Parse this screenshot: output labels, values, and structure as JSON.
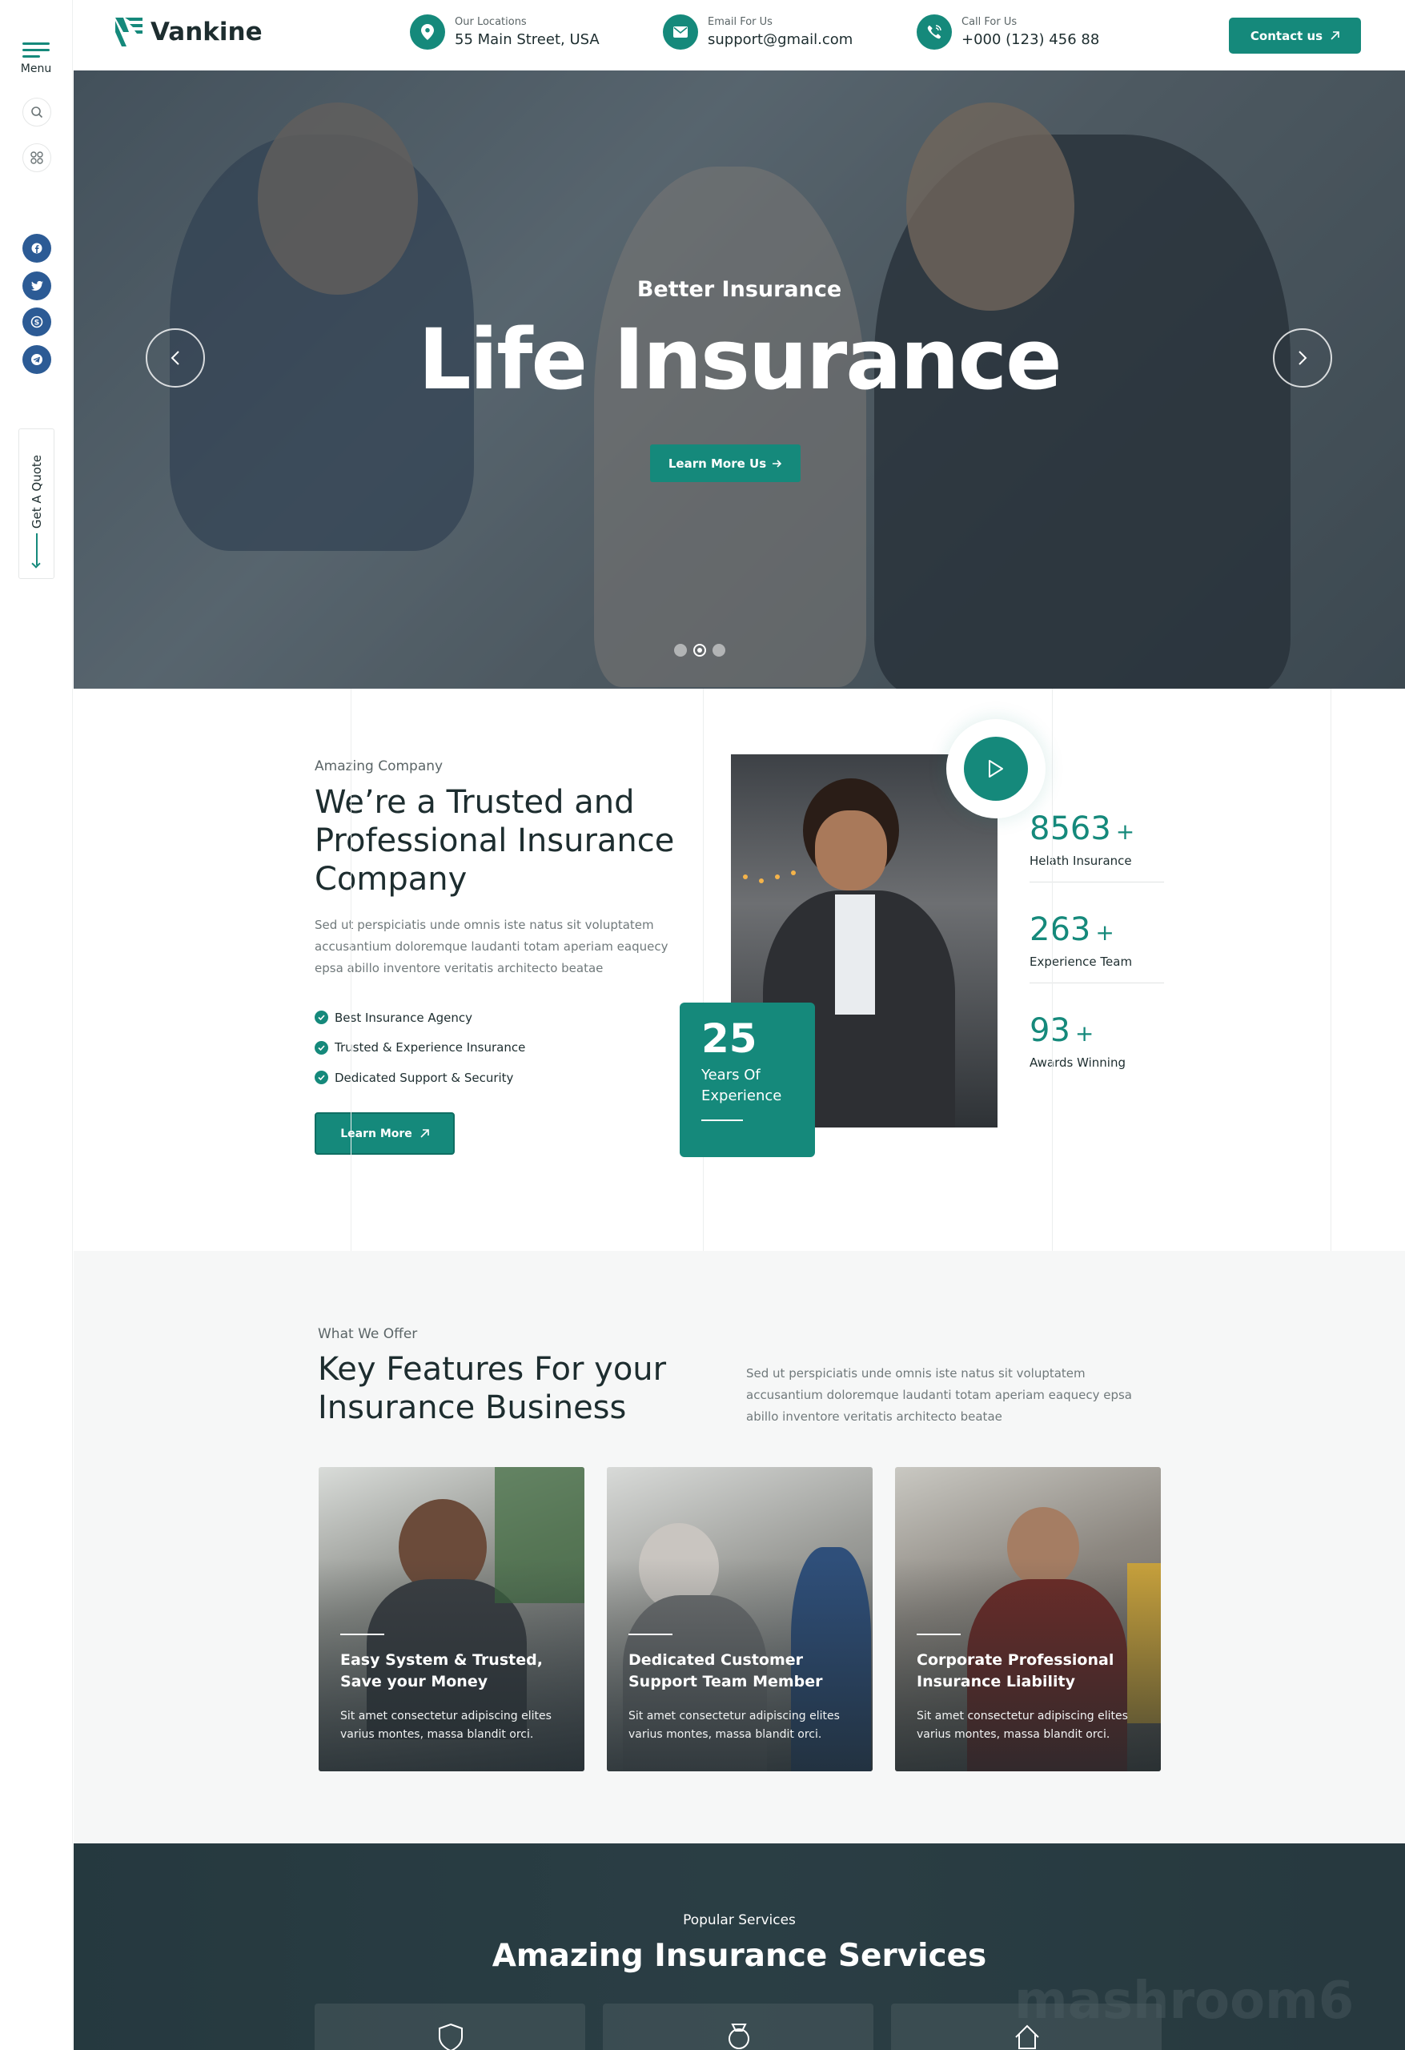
{
  "sidebar": {
    "menu_label": "Menu",
    "quote_label": "Get A Quote",
    "social": [
      "facebook-icon",
      "twitter-icon",
      "skype-icon",
      "telegram-icon"
    ]
  },
  "header": {
    "logo_text": "Vankine",
    "location": {
      "label": "Our Locations",
      "value": "55 Main Street, USA"
    },
    "email": {
      "label": "Email For Us",
      "value": "support@gmail.com"
    },
    "phone": {
      "label": "Call For Us",
      "value": "+000 (123) 456 88"
    },
    "contact_button": "Contact us"
  },
  "hero": {
    "subtitle": "Better Insurance",
    "title": "Life Insurance",
    "button": "Learn More Us",
    "slides": 3,
    "active_slide": 2
  },
  "about": {
    "tag": "Amazing Company",
    "title": "We’re a Trusted and Professional Insurance Company",
    "text": "Sed ut perspiciatis unde omnis iste natus sit voluptatem accusantium doloremque laudanti totam aperiam eaquecy epsa abillo inventore veritatis architecto beatae",
    "checks": [
      "Best Insurance Agency",
      "Trusted & Experience Insurance",
      "Dedicated Support & Security"
    ],
    "button": "Learn More",
    "experience": {
      "number": "25",
      "label": "Years Of Experience"
    },
    "stats": [
      {
        "value": "8563",
        "plus": "+",
        "label": "Helath Insurance"
      },
      {
        "value": "263",
        "plus": "+",
        "label": "Experience Team"
      },
      {
        "value": "93",
        "plus": "+",
        "label": "Awards Winning"
      }
    ]
  },
  "features": {
    "tag": "What We Offer",
    "title": "Key Features For your Insurance Business",
    "text": "Sed ut perspiciatis unde omnis iste natus sit voluptatem accusantium doloremque laudanti totam aperiam eaquecy epsa abillo inventore veritatis architecto beatae",
    "cards": [
      {
        "title": "Easy System & Trusted, Save your Money",
        "text": "Sit amet consectetur adipiscing elites varius montes, massa blandit orci."
      },
      {
        "title": "Dedicated Customer Support Team Member",
        "text": "Sit amet consectetur adipiscing elites varius montes, massa blandit orci."
      },
      {
        "title": "Corporate Professional Insurance Liability",
        "text": "Sit amet consectetur adipiscing elites varius montes, massa blandit orci."
      }
    ]
  },
  "services": {
    "tag": "Popular Services",
    "title": "Amazing Insurance Services",
    "watermark": "mashroom6"
  },
  "colors": {
    "accent": "#15897b",
    "dark": "#1d2d2f",
    "social": "#2c5b95"
  }
}
